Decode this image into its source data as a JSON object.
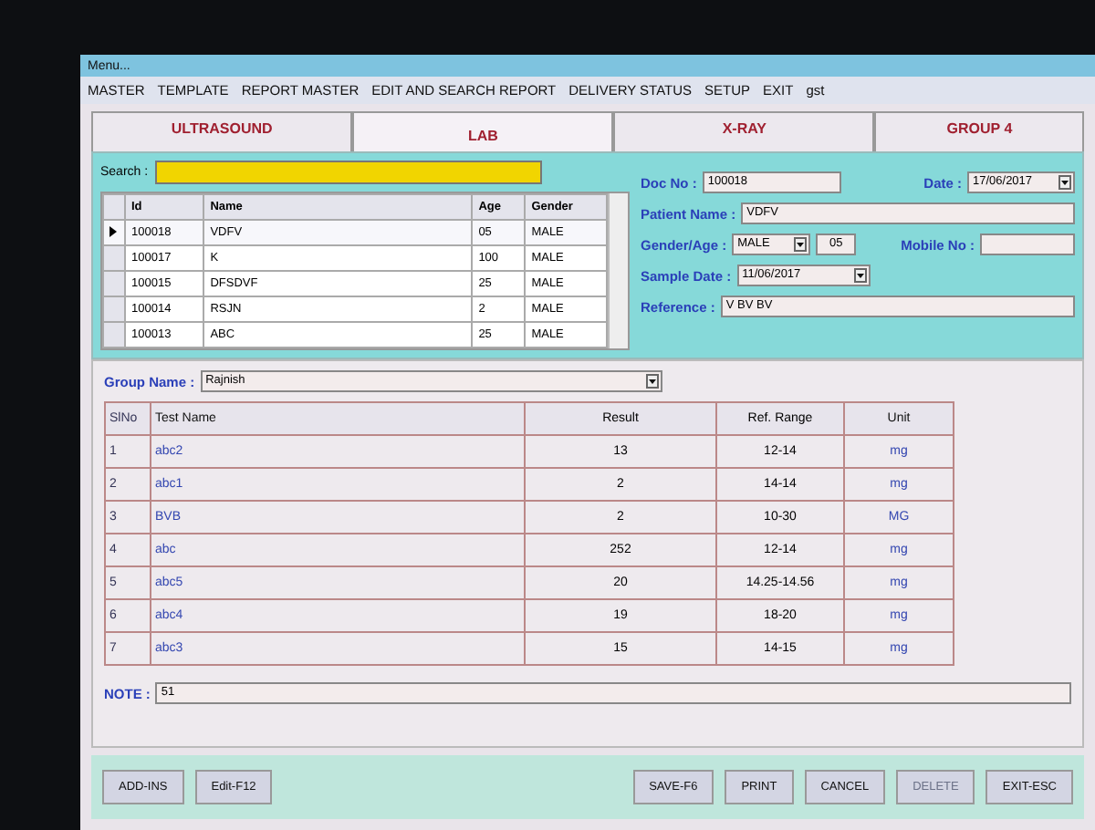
{
  "window": {
    "title": "Menu..."
  },
  "menu": [
    "MASTER",
    "TEMPLATE",
    "REPORT MASTER",
    "EDIT AND SEARCH REPORT",
    "DELIVERY STATUS",
    "SETUP",
    "EXIT",
    "gst"
  ],
  "tabs": [
    {
      "label": "ULTRASOUND",
      "selected": false
    },
    {
      "label": "LAB",
      "selected": true
    },
    {
      "label": "X-RAY",
      "selected": false
    },
    {
      "label": "GROUP 4",
      "selected": false
    }
  ],
  "search": {
    "label": "Search :"
  },
  "patients": {
    "columns": [
      "Id",
      "Name",
      "Age",
      "Gender"
    ],
    "rows": [
      {
        "id": "100018",
        "name": "VDFV",
        "age": "05",
        "gender": "MALE",
        "selected": true
      },
      {
        "id": "100017",
        "name": "K",
        "age": "100",
        "gender": "MALE",
        "selected": false
      },
      {
        "id": "100015",
        "name": "DFSDVF",
        "age": "25",
        "gender": "MALE",
        "selected": false
      },
      {
        "id": "100014",
        "name": "RSJN",
        "age": "2",
        "gender": "MALE",
        "selected": false
      },
      {
        "id": "100013",
        "name": "ABC",
        "age": "25",
        "gender": "MALE",
        "selected": false
      }
    ]
  },
  "form": {
    "doc_no_label": "Doc No :",
    "doc_no": "100018",
    "date_label": "Date :",
    "date": "17/06/2017",
    "patient_name_label": "Patient Name :",
    "patient_name": "VDFV",
    "gender_age_label": "Gender/Age :",
    "gender": "MALE",
    "age": "05",
    "mobile_label": "Mobile No :",
    "sample_date_label": "Sample Date :",
    "sample_date": "11/06/2017",
    "reference_label": "Reference :",
    "reference": "V BV BV"
  },
  "group": {
    "label": "Group Name :",
    "value": "Rajnish"
  },
  "tests": {
    "columns": [
      "SlNo",
      "Test Name",
      "Result",
      "Ref. Range",
      "Unit"
    ],
    "rows": [
      [
        "1",
        "abc2",
        "13",
        "12-14",
        "mg"
      ],
      [
        "2",
        "abc1",
        "2",
        "14-14",
        "mg"
      ],
      [
        "3",
        "BVB",
        "2",
        "10-30",
        "MG"
      ],
      [
        "4",
        "abc",
        "252",
        "12-14",
        "mg"
      ],
      [
        "5",
        "abc5",
        "20",
        "14.25-14.56",
        "mg"
      ],
      [
        "6",
        "abc4",
        "19",
        "18-20",
        "mg"
      ],
      [
        "7",
        "abc3",
        "15",
        "14-15",
        "mg"
      ]
    ]
  },
  "note": {
    "label": "NOTE :",
    "value": "51"
  },
  "buttons_left": [
    {
      "label": "ADD-INS",
      "disabled": false
    },
    {
      "label": "Edit-F12",
      "disabled": false
    }
  ],
  "buttons_right": [
    {
      "label": "SAVE-F6",
      "disabled": false
    },
    {
      "label": "PRINT",
      "disabled": false
    },
    {
      "label": "CANCEL",
      "disabled": false
    },
    {
      "label": "DELETE",
      "disabled": true
    },
    {
      "label": "EXIT-ESC",
      "disabled": false
    }
  ]
}
